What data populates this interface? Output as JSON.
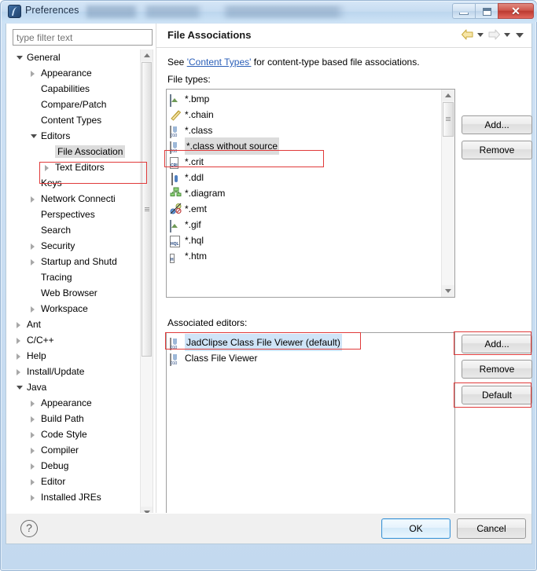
{
  "window": {
    "title": "Preferences",
    "app_icon": "eclipse-icon",
    "buttons": {
      "minimize": "minimize-icon",
      "maximize": "maximize-icon",
      "close": "✕"
    }
  },
  "filter": {
    "placeholder": "type filter text",
    "value": ""
  },
  "tree": {
    "items": [
      {
        "label": "General",
        "indent": 0,
        "state": "expanded",
        "selected": false
      },
      {
        "label": "Appearance",
        "indent": 1,
        "state": "collapsed",
        "selected": false
      },
      {
        "label": "Capabilities",
        "indent": 1,
        "state": "leaf",
        "selected": false
      },
      {
        "label": "Compare/Patch",
        "indent": 1,
        "state": "leaf",
        "selected": false
      },
      {
        "label": "Content Types",
        "indent": 1,
        "state": "leaf",
        "selected": false
      },
      {
        "label": "Editors",
        "indent": 1,
        "state": "expanded",
        "selected": false
      },
      {
        "label": "File Association",
        "indent": 2,
        "state": "leaf",
        "selected": true
      },
      {
        "label": "Text Editors",
        "indent": 2,
        "state": "collapsed",
        "selected": false
      },
      {
        "label": "Keys",
        "indent": 1,
        "state": "leaf",
        "selected": false
      },
      {
        "label": "Network Connecti",
        "indent": 1,
        "state": "collapsed",
        "selected": false
      },
      {
        "label": "Perspectives",
        "indent": 1,
        "state": "leaf",
        "selected": false
      },
      {
        "label": "Search",
        "indent": 1,
        "state": "leaf",
        "selected": false
      },
      {
        "label": "Security",
        "indent": 1,
        "state": "collapsed",
        "selected": false
      },
      {
        "label": "Startup and Shutd",
        "indent": 1,
        "state": "collapsed",
        "selected": false
      },
      {
        "label": "Tracing",
        "indent": 1,
        "state": "leaf",
        "selected": false
      },
      {
        "label": "Web Browser",
        "indent": 1,
        "state": "leaf",
        "selected": false
      },
      {
        "label": "Workspace",
        "indent": 1,
        "state": "collapsed",
        "selected": false
      },
      {
        "label": "Ant",
        "indent": 0,
        "state": "collapsed",
        "selected": false
      },
      {
        "label": "C/C++",
        "indent": 0,
        "state": "collapsed",
        "selected": false
      },
      {
        "label": "Help",
        "indent": 0,
        "state": "collapsed",
        "selected": false
      },
      {
        "label": "Install/Update",
        "indent": 0,
        "state": "collapsed",
        "selected": false
      },
      {
        "label": "Java",
        "indent": 0,
        "state": "expanded",
        "selected": false
      },
      {
        "label": "Appearance",
        "indent": 1,
        "state": "collapsed",
        "selected": false
      },
      {
        "label": "Build Path",
        "indent": 1,
        "state": "collapsed",
        "selected": false
      },
      {
        "label": "Code Style",
        "indent": 1,
        "state": "collapsed",
        "selected": false
      },
      {
        "label": "Compiler",
        "indent": 1,
        "state": "collapsed",
        "selected": false
      },
      {
        "label": "Debug",
        "indent": 1,
        "state": "collapsed",
        "selected": false
      },
      {
        "label": "Editor",
        "indent": 1,
        "state": "collapsed",
        "selected": false
      },
      {
        "label": "Installed JREs",
        "indent": 1,
        "state": "collapsed",
        "selected": false
      }
    ]
  },
  "pane": {
    "title": "File Associations",
    "nav": {
      "back": "back-arrow-icon",
      "back_menu": "chevron-down-icon",
      "forward": "forward-arrow-icon",
      "forward_menu": "chevron-down-icon",
      "view_menu": "chevron-down-icon"
    },
    "description_prefix": "See ",
    "description_link": "'Content Types'",
    "description_suffix": " for content-type based file associations.",
    "file_types_label": "File types:",
    "associated_editors_label": "Associated editors:"
  },
  "file_types": {
    "rows": [
      {
        "label": "*.bmp",
        "icon": "image-file-icon",
        "selected": false
      },
      {
        "label": "*.chain",
        "icon": "chain-file-icon",
        "selected": false
      },
      {
        "label": "*.class",
        "icon": "class-file-icon",
        "selected": false
      },
      {
        "label": "*.class without source",
        "icon": "class-file-icon",
        "selected": true
      },
      {
        "label": "*.crit",
        "icon": "crit-file-icon",
        "selected": false
      },
      {
        "label": "*.ddl",
        "icon": "ddl-file-icon",
        "selected": false
      },
      {
        "label": "*.diagram",
        "icon": "diagram-file-icon",
        "selected": false
      },
      {
        "label": "*.emt",
        "icon": "emt-file-icon",
        "selected": false
      },
      {
        "label": "*.gif",
        "icon": "image-file-icon",
        "selected": false
      },
      {
        "label": "*.hql",
        "icon": "hql-file-icon",
        "selected": false
      },
      {
        "label": "*.htm",
        "icon": "html-file-icon",
        "selected": false
      }
    ],
    "buttons": {
      "add": "Add...",
      "remove": "Remove"
    }
  },
  "associated_editors": {
    "rows": [
      {
        "label": "JadClipse Class File Viewer (default)",
        "icon": "class-file-icon",
        "selected": true
      },
      {
        "label": "Class File Viewer",
        "icon": "class-file-icon",
        "selected": false
      }
    ],
    "buttons": {
      "add": "Add...",
      "remove": "Remove",
      "default": "Default"
    }
  },
  "footer": {
    "help": "?",
    "ok": "OK",
    "cancel": "Cancel"
  },
  "colors": {
    "accent": "#3c93d6",
    "annotation": "#e03a3a",
    "selection": "#dcdcdc",
    "link": "#2b5fb8"
  }
}
